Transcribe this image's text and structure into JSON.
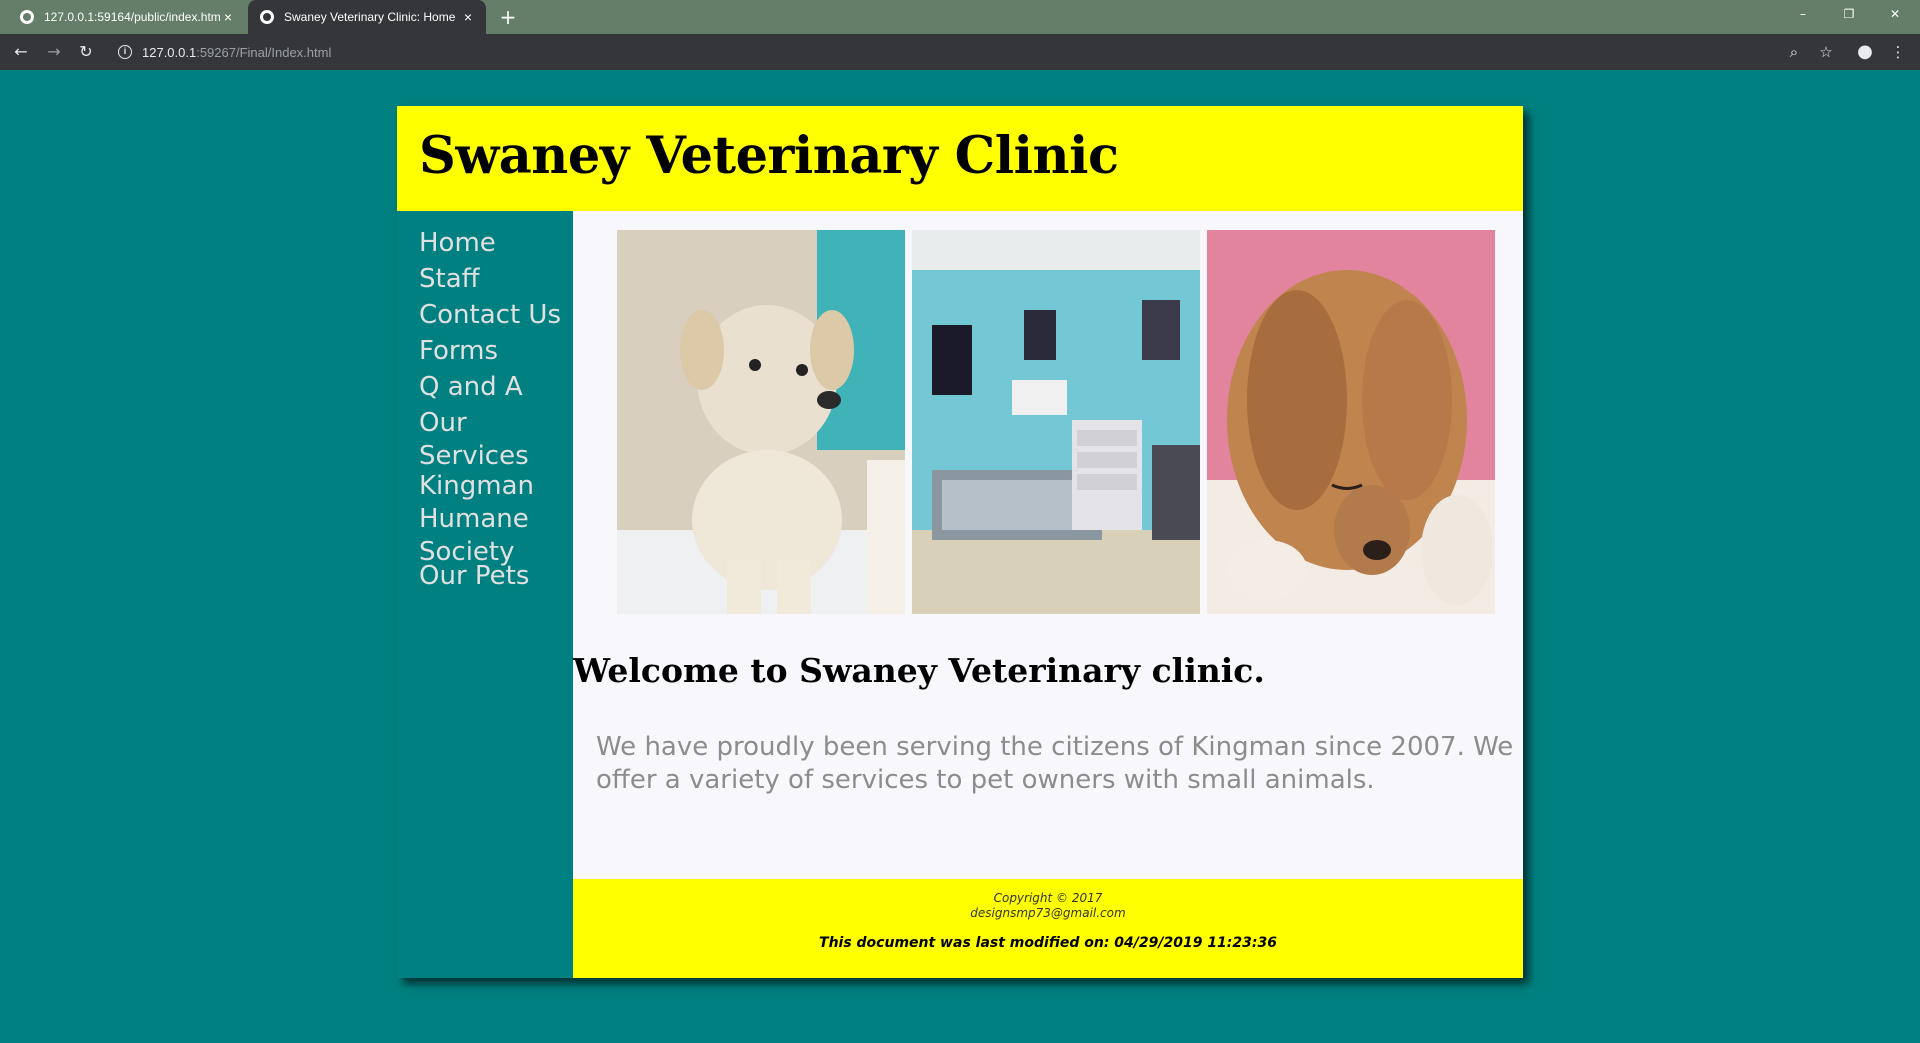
{
  "browser": {
    "tabs": [
      {
        "title": "127.0.0.1:59164/public/index.htm",
        "close": "×"
      },
      {
        "title": "Swaney Veterinary Clinic: Home",
        "close": "×"
      }
    ],
    "new_tab": "+",
    "window_controls": {
      "minimize": "–",
      "restore": "❐",
      "close": "✕"
    },
    "nav": {
      "back": "←",
      "forward": "→",
      "reload": "↻",
      "menu": "⋮"
    },
    "address": {
      "host": "127.0.0.1",
      "path": ":59267/Final/Index.html"
    },
    "icons": {
      "info": "i",
      "zoom": "⌕",
      "bookmark": "☆",
      "profile": "●"
    }
  },
  "site": {
    "title": "Swaney Veterinary Clinic",
    "nav": [
      {
        "label": "Home"
      },
      {
        "label": "Staff"
      },
      {
        "label": "Contact Us"
      },
      {
        "label": "Forms"
      },
      {
        "label": "Q and A"
      },
      {
        "label": "Our Services"
      },
      {
        "label": "Kingman Humane Society"
      },
      {
        "label": "Our Pets"
      }
    ],
    "welcome_heading": "Welcome to Swaney Veterinary clinic.",
    "intro": "We have proudly been serving the citizens of Kingman since 2007. We offer a variety of services to pet owners with small animals.",
    "footer": {
      "copyright": "Copyright © 2017",
      "email": "designsmp73@gmail.com",
      "modified": "This document was last modified on: 04/29/2019 11:23:36"
    }
  },
  "colors": {
    "page_bg": "#008080",
    "header_bg": "#ffff00",
    "content_bg": "#f8f8fc",
    "nav_text": "#e0e0e0",
    "intro_text": "#8c8c8c"
  }
}
